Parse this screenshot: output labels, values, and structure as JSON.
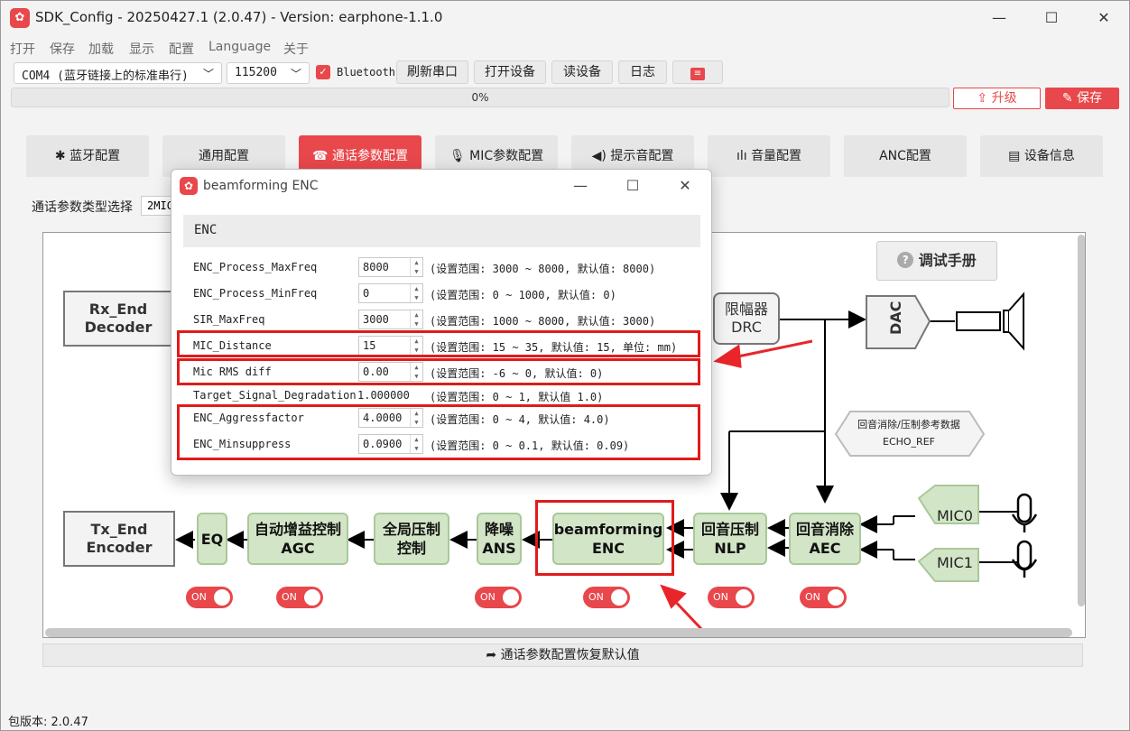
{
  "window": {
    "title": "SDK_Config -  20250427.1  (2.0.47) - Version: earphone-1.1.0",
    "min": "—",
    "max": "☐",
    "close": "✕"
  },
  "menu": [
    "打开",
    "保存",
    "加载",
    "显示",
    "配置",
    "Language",
    "关于"
  ],
  "toolbar": {
    "port": "COM4 (蓝牙链接上的标准串行)",
    "baud": "115200",
    "bluetooth_label": "Bluetooth",
    "refresh": "刷新串口",
    "open_device": "打开设备",
    "read_device": "读设备",
    "log": "日志"
  },
  "progress": {
    "text": "0%",
    "value": 0
  },
  "actions": {
    "upgrade": "升级",
    "save": "保存"
  },
  "tabs": [
    {
      "label": "蓝牙配置",
      "icon": "bluetooth-icon"
    },
    {
      "label": "通用配置",
      "icon": ""
    },
    {
      "label": "通话参数配置",
      "icon": "phone-settings-icon"
    },
    {
      "label": "MIC参数配置",
      "icon": "mic-icon"
    },
    {
      "label": "提示音配置",
      "icon": "speaker-icon"
    },
    {
      "label": "音量配置",
      "icon": "volume-bars-icon"
    },
    {
      "label": "ANC配置",
      "icon": ""
    },
    {
      "label": "设备信息",
      "icon": "clipboard-icon"
    }
  ],
  "selector": {
    "label": "通话参数类型选择",
    "value": "2MIC"
  },
  "diagram": {
    "help_button": "调试手册",
    "rx_end": [
      "Rx_End",
      "Decoder"
    ],
    "drc": [
      "限幅器",
      "DRC"
    ],
    "dac": "DAC",
    "echo_ref": [
      "回音消除/压制参考数据",
      "ECHO_REF"
    ],
    "tx_end": [
      "Tx_End",
      "Encoder"
    ],
    "eq": "EQ",
    "agc": [
      "自动增益控制",
      "AGC"
    ],
    "global": [
      "全局压制",
      "控制"
    ],
    "ans": [
      "降噪",
      "ANS"
    ],
    "enc": [
      "beamforming",
      "ENC"
    ],
    "nlp": [
      "回音压制",
      "NLP"
    ],
    "aec": [
      "回音消除",
      "AEC"
    ],
    "mic0": "MIC0",
    "mic1": "MIC1",
    "toggle_label": "ON"
  },
  "reset_button": "通话参数配置恢复默认值",
  "version": "包版本:  2.0.47",
  "dialog": {
    "title": "beamforming ENC",
    "section": "ENC",
    "params": [
      {
        "name": "ENC_Process_MaxFreq",
        "value": "8000",
        "range": "(设置范围: 3000 ~ 8000, 默认值: 8000)",
        "spin": true
      },
      {
        "name": "ENC_Process_MinFreq",
        "value": "0",
        "range": "(设置范围: 0 ~ 1000, 默认值: 0)",
        "spin": true
      },
      {
        "name": "SIR_MaxFreq",
        "value": "3000",
        "range": "(设置范围: 1000 ~ 8000, 默认值: 3000)",
        "spin": true
      },
      {
        "name": "MIC_Distance",
        "value": "15",
        "range": "(设置范围: 15 ~ 35, 默认值: 15, 单位: mm)",
        "spin": true
      },
      {
        "name": "Mic RMS diff",
        "value": "0.00",
        "range": "(设置范围: -6 ~ 0, 默认值: 0)",
        "spin": true
      },
      {
        "name": "Target_Signal_Degradation",
        "value": "1.000000",
        "range": "(设置范围: 0 ~ 1, 默认值 1.0)",
        "spin": false
      },
      {
        "name": "ENC_Aggressfactor",
        "value": "4.0000",
        "range": "(设置范围: 0 ~ 4, 默认值: 4.0)",
        "spin": true
      },
      {
        "name": "ENC_Minsuppress",
        "value": "0.0900",
        "range": "(设置范围: 0 ~ 0.1, 默认值: 0.09)",
        "spin": true
      }
    ]
  },
  "colors": {
    "accent": "#e8474b",
    "block_green": "#d3e5c7",
    "highlight_red": "#e01b1b"
  }
}
